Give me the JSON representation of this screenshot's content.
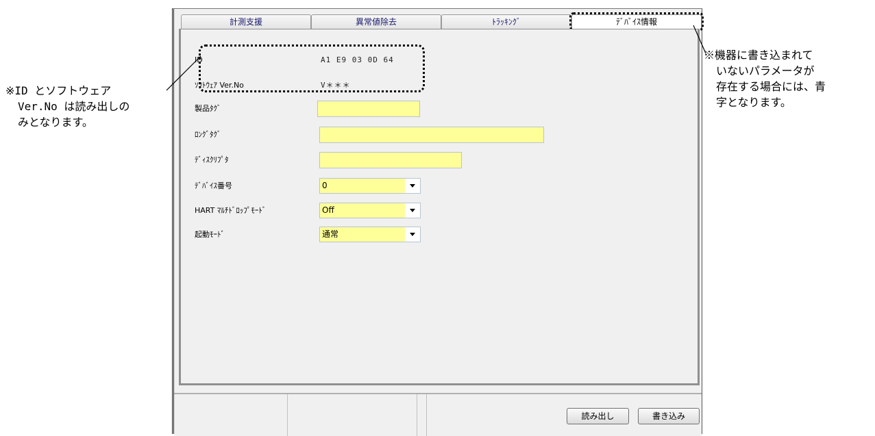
{
  "tabs": [
    {
      "label": "計測支援"
    },
    {
      "label": "異常値除去"
    },
    {
      "label": "ﾄﾗｯｷﾝｸﾞ"
    },
    {
      "label": "ﾃﾞﾊﾞｲｽ情報"
    }
  ],
  "active_tab": "ﾃﾞﾊﾞｲｽ情報",
  "readonly": {
    "id_label": "ID",
    "id_value": "A1  E9  03  0D  64",
    "sw_label": "ｿﾌﾄｳｪｱ Ver.No",
    "sw_value": "V＊＊＊"
  },
  "fields": {
    "product_tag_label": "製品ﾀｸﾞ",
    "product_tag_value": "",
    "long_tag_label": "ﾛﾝｸﾞﾀｸﾞ",
    "long_tag_value": "",
    "descriptor_label": "ﾃﾞｨｽｸﾘﾌﾟﾀ",
    "descriptor_value": "",
    "device_number_label": "ﾃﾞﾊﾞｲｽ番号",
    "device_number_value": "0",
    "hart_multidrop_label": "HART ﾏﾙﾁﾄﾞﾛｯﾌﾟﾓｰﾄﾞ",
    "hart_multidrop_value": "Off",
    "startup_mode_label": "起動ﾓｰﾄﾞ",
    "startup_mode_value": "通常"
  },
  "buttons": {
    "read_label": "読み出し",
    "write_label": "書き込み"
  },
  "notes": {
    "left": [
      "※ID とソフトウェア",
      "Ver.No は読み出しの",
      "みとなります。"
    ],
    "right": [
      "※機器に書き込まれて",
      "いないパラメータが",
      "存在する場合には、青",
      "字となります。"
    ]
  },
  "colors": {
    "field_bg": "#ffff99",
    "window_bg": "#f0f0f0",
    "annotation": "#000000"
  }
}
